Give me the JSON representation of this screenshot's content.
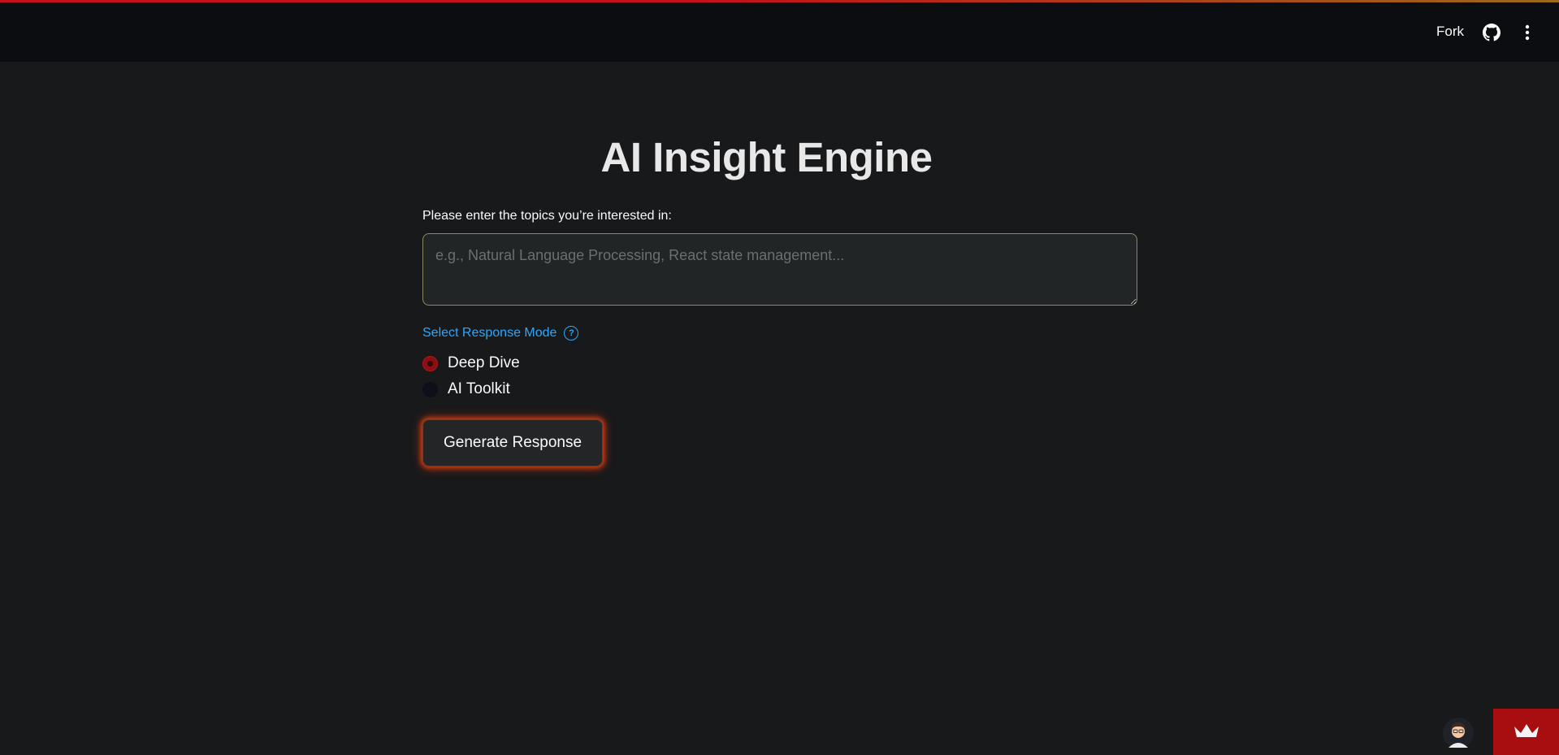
{
  "header": {
    "fork_label": "Fork",
    "github_icon": "github-icon",
    "menu_icon": "more-vertical-icon"
  },
  "main": {
    "title": "AI Insight Engine",
    "topics_label": "Please enter the topics you’re interested in:",
    "topics_placeholder": "e.g., Natural Language Processing, React state management...",
    "topics_value": "",
    "mode_label": "Select Response Mode",
    "help_icon": "question-circle-icon",
    "modes": [
      {
        "label": "Deep Dive",
        "selected": true
      },
      {
        "label": "AI Toolkit",
        "selected": false
      }
    ],
    "generate_label": "Generate Response"
  },
  "colors": {
    "background": "#18191b",
    "header": "#0b0d11",
    "accent_red": "#a80d0f",
    "link_blue": "#2aa8ff",
    "glow": "#d63a12"
  },
  "footer": {
    "avatar_icon": "user-avatar-icon",
    "badge_icon": "crown-icon"
  }
}
